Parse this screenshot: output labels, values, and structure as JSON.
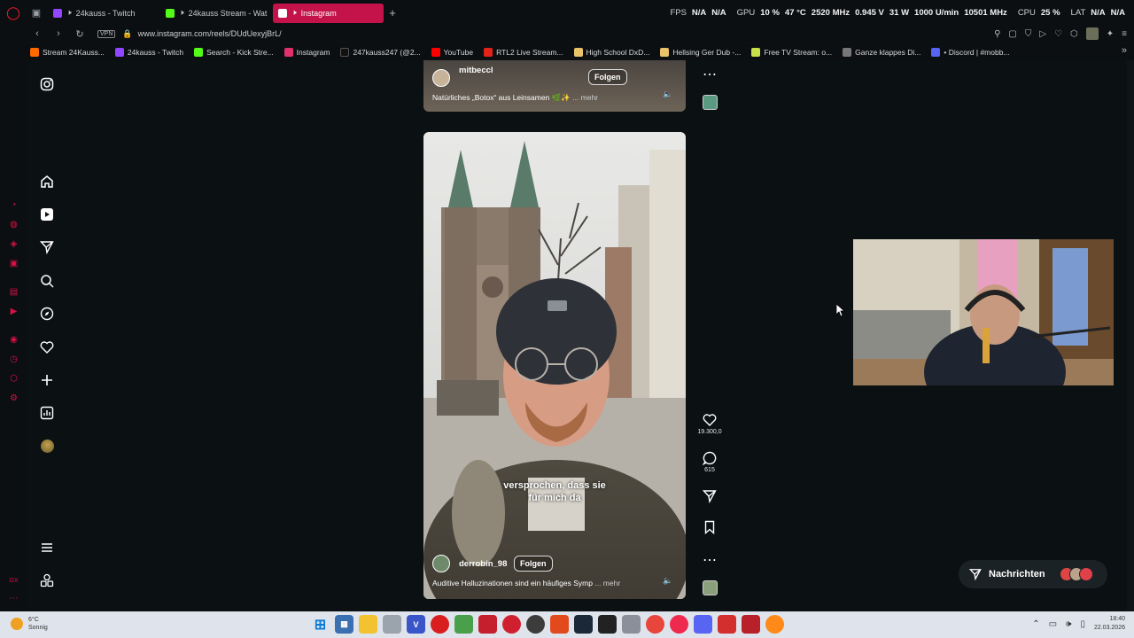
{
  "browser": {
    "tabs": [
      {
        "label": "24kauss - Twitch",
        "muted": true,
        "color": "#9146ff"
      },
      {
        "label": "24kauss Stream - Wat",
        "muted": true,
        "color": "#53fc18"
      },
      {
        "label": "Instagram",
        "muted": true,
        "active": true,
        "color": "#e1306c"
      }
    ],
    "url": "www.instagram.com/reels/DUdUexyjBrL/",
    "vpn_label": "VPN",
    "hw": {
      "fps_label": "FPS",
      "fps_value": "N/A",
      "fps_value2": "N/A",
      "gpu_label": "GPU",
      "gpu_load": "10 %",
      "gpu_temp": "47 °C",
      "gpu_clock": "2520 MHz",
      "gpu_volt": "0.945 V",
      "gpu_power": "31 W",
      "gpu_fan": "1000 U/min",
      "gpu_mem": "10501 MHz",
      "cpu_label": "CPU",
      "cpu_load": "25 %",
      "lat_label": "LAT",
      "lat_value": "N/A",
      "lat_value2": "N/A"
    },
    "bookmarks": [
      {
        "label": "Stream 24Kauss...",
        "color": "#ff6a00"
      },
      {
        "label": "24kauss - Twitch",
        "color": "#9146ff"
      },
      {
        "label": "Search - Kick Stre...",
        "color": "#53fc18"
      },
      {
        "label": "Instagram",
        "color": "#e1306c"
      },
      {
        "label": "247kauss247 (@2...",
        "color": "#111111"
      },
      {
        "label": "YouTube",
        "color": "#ff0000"
      },
      {
        "label": "RTL2 Live Stream...",
        "color": "#e2231a"
      },
      {
        "label": "High School DxD...",
        "color": "#e8c36a"
      },
      {
        "label": "Hellsing Ger Dub -...",
        "color": "#e8c36a"
      },
      {
        "label": "Free TV Stream: o...",
        "color": "#c8e04a"
      },
      {
        "label": "Ganze klappes Di...",
        "color": "#777777"
      },
      {
        "label": "• Discord | #mobb...",
        "color": "#5865f2"
      }
    ]
  },
  "reels": {
    "top": {
      "username": "mitbeccl",
      "follow_label": "Folgen",
      "caption": "Natürliches „Botox“ aus Leinsamen 🌿✨",
      "more_label": "... mehr"
    },
    "main": {
      "username": "derrobin_98",
      "follow_label": "Folgen",
      "caption": "Auditive Halluzinationen sind ein häufiges Symp",
      "more_label": "... mehr",
      "subtitle_line1": "versprochen, dass sie",
      "subtitle_line2": "für mich da",
      "likes": "19.300,0",
      "comments": "615"
    }
  },
  "messages": {
    "label": "Nachrichten"
  },
  "taskbar": {
    "weather_temp": "6°C",
    "weather_desc": "Sonnig",
    "time": "18:40",
    "date": "22.03.2026"
  }
}
